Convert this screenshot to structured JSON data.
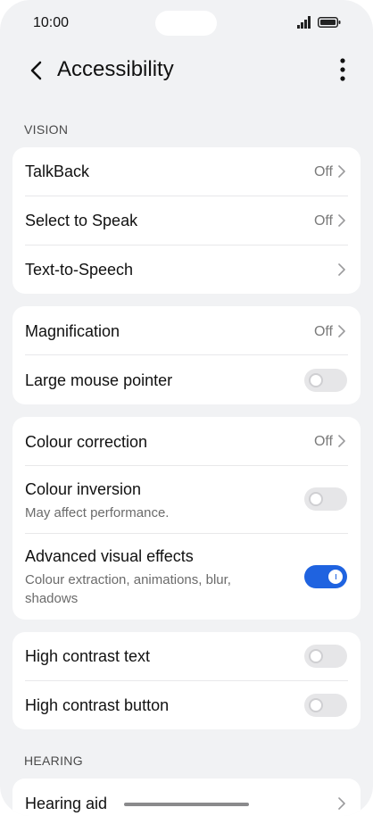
{
  "status_bar": {
    "time": "10:00"
  },
  "header": {
    "title": "Accessibility"
  },
  "sections": {
    "vision": "VISION",
    "hearing": "HEARING"
  },
  "vision_group_1": {
    "talkback": {
      "label": "TalkBack",
      "value": "Off"
    },
    "select_to_speak": {
      "label": "Select to Speak",
      "value": "Off"
    },
    "text_to_speech": {
      "label": "Text-to-Speech"
    }
  },
  "vision_group_2": {
    "magnification": {
      "label": "Magnification",
      "value": "Off"
    },
    "large_mouse_pointer": {
      "label": "Large mouse pointer",
      "enabled": false
    }
  },
  "vision_group_3": {
    "colour_correction": {
      "label": "Colour correction",
      "value": "Off"
    },
    "colour_inversion": {
      "label": "Colour inversion",
      "subtitle": "May affect performance.",
      "enabled": false
    },
    "advanced_visual_effects": {
      "label": "Advanced visual effects",
      "subtitle": "Colour extraction, animations, blur, shadows",
      "enabled": true
    }
  },
  "vision_group_4": {
    "high_contrast_text": {
      "label": "High contrast text",
      "enabled": false
    },
    "high_contrast_button": {
      "label": "High contrast button",
      "enabled": false
    }
  },
  "hearing_group": {
    "hearing_aid": {
      "label": "Hearing aid"
    }
  },
  "colors": {
    "accent": "#1f63e0",
    "background": "#f1f2f4",
    "card": "#ffffff"
  }
}
